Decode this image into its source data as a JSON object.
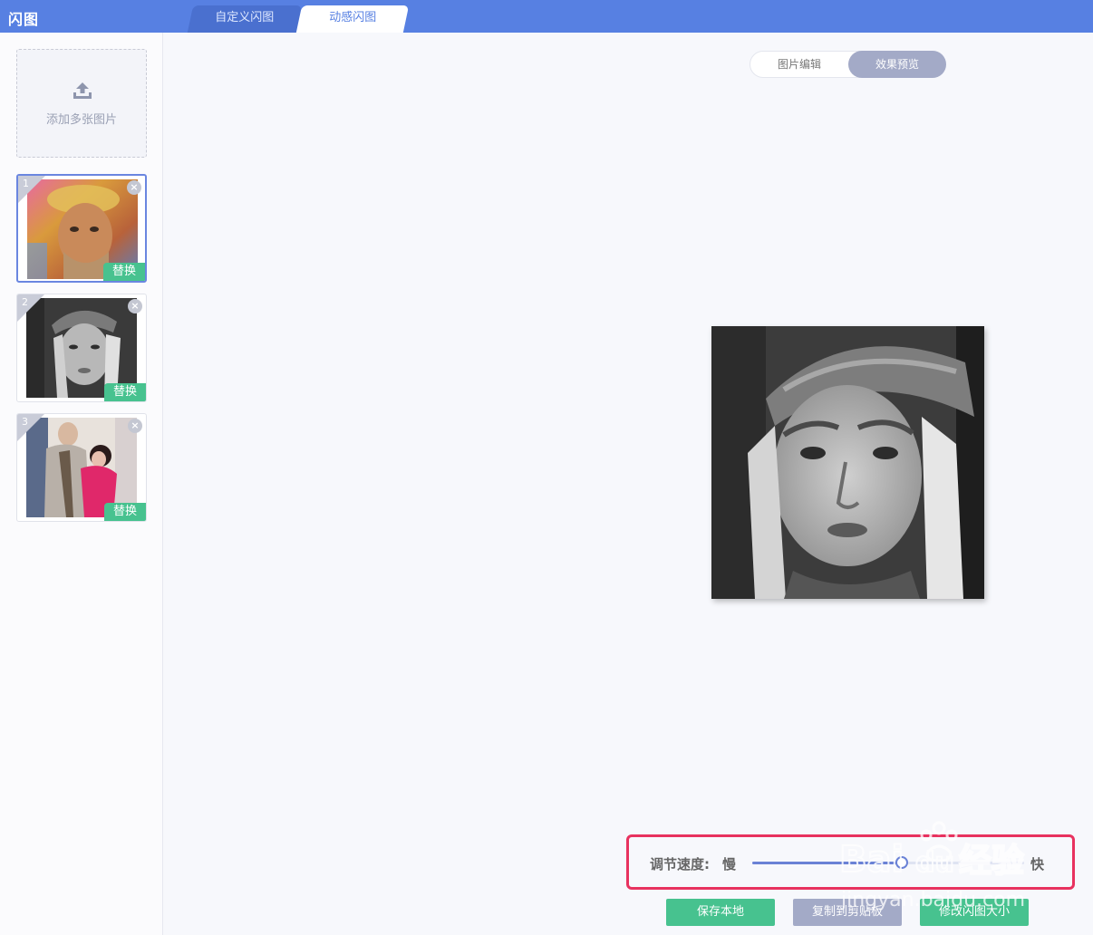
{
  "app": {
    "title": "闪图"
  },
  "tabs": [
    {
      "label": "自定义闪图",
      "active": false
    },
    {
      "label": "动感闪图",
      "active": true
    }
  ],
  "sidebar": {
    "upload_label": "添加多张图片",
    "upload_icon": "upload-icon",
    "thumbnails": [
      {
        "index": "1",
        "replace_label": "替换",
        "close": "×",
        "selected": true,
        "style": "color"
      },
      {
        "index": "2",
        "replace_label": "替换",
        "close": "×",
        "selected": false,
        "style": "grayscale"
      },
      {
        "index": "3",
        "replace_label": "替换",
        "close": "×",
        "selected": false,
        "style": "color"
      }
    ]
  },
  "view_toggle": {
    "edit_label": "图片编辑",
    "preview_label": "效果预览",
    "active": "preview"
  },
  "speed": {
    "label": "调节速度:",
    "slow": "慢",
    "fast": "快",
    "value_fraction": 0.55
  },
  "actions": {
    "save": "保存本地",
    "copy": "复制到剪贴板",
    "resize": "修改闪图大小"
  },
  "colors": {
    "topbar": "#5780e2",
    "accent_green": "#47c28f",
    "muted_purple": "#a3aac7",
    "highlight_red": "#e8325f"
  }
}
